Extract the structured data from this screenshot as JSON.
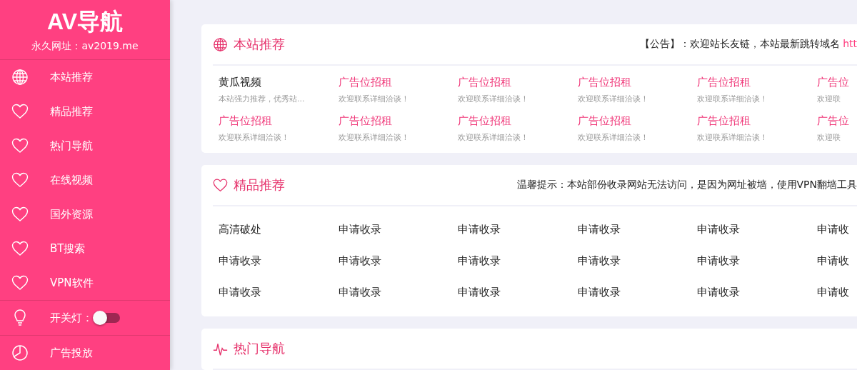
{
  "sidebar": {
    "logo": "AV导航",
    "permanent_url": "永久网址：av2019.me",
    "items": [
      {
        "label": "本站推荐"
      },
      {
        "label": "精品推荐"
      },
      {
        "label": "热门导航"
      },
      {
        "label": "在线视频"
      },
      {
        "label": "国外资源"
      },
      {
        "label": "BT搜索"
      },
      {
        "label": "VPN软件"
      }
    ],
    "light_switch": {
      "label": "开关灯：",
      "on": false
    },
    "footer_item": {
      "label": "广告投放"
    }
  },
  "sections": [
    {
      "title": "本站推荐",
      "notice": "【公告】：欢迎站长友链，本站最新跳转域名 ",
      "notice_link": "htt",
      "links": [
        {
          "kind": "featured",
          "name": "黄瓜视频",
          "desc": "本站强力推荐，优秀站..."
        },
        {
          "kind": "ad",
          "name": "广告位招租",
          "desc": "欢迎联系详细洽谈！"
        },
        {
          "kind": "ad",
          "name": "广告位招租",
          "desc": "欢迎联系详细洽谈！"
        },
        {
          "kind": "ad",
          "name": "广告位招租",
          "desc": "欢迎联系详细洽谈！"
        },
        {
          "kind": "ad",
          "name": "广告位招租",
          "desc": "欢迎联系详细洽谈！"
        },
        {
          "kind": "ad",
          "name": "广告位",
          "desc": "欢迎联"
        },
        {
          "kind": "ad",
          "name": "广告位招租",
          "desc": "欢迎联系详细洽谈！"
        },
        {
          "kind": "ad",
          "name": "广告位招租",
          "desc": "欢迎联系详细洽谈！"
        },
        {
          "kind": "ad",
          "name": "广告位招租",
          "desc": "欢迎联系详细洽谈！"
        },
        {
          "kind": "ad",
          "name": "广告位招租",
          "desc": "欢迎联系详细洽谈！"
        },
        {
          "kind": "ad",
          "name": "广告位招租",
          "desc": "欢迎联系详细洽谈！"
        },
        {
          "kind": "ad",
          "name": "广告位",
          "desc": "欢迎联"
        }
      ]
    },
    {
      "title": "精品推荐",
      "notice": "温馨提示：本站部份收录网站无法访问，是因为网址被墙，使用VPN翻墙工具",
      "links": [
        {
          "kind": "plain",
          "name": "高清破处"
        },
        {
          "kind": "plain",
          "name": "申请收录"
        },
        {
          "kind": "plain",
          "name": "申请收录"
        },
        {
          "kind": "plain",
          "name": "申请收录"
        },
        {
          "kind": "plain",
          "name": "申请收录"
        },
        {
          "kind": "plain",
          "name": "申请收"
        },
        {
          "kind": "plain",
          "name": "申请收录"
        },
        {
          "kind": "plain",
          "name": "申请收录"
        },
        {
          "kind": "plain",
          "name": "申请收录"
        },
        {
          "kind": "plain",
          "name": "申请收录"
        },
        {
          "kind": "plain",
          "name": "申请收录"
        },
        {
          "kind": "plain",
          "name": "申请收"
        },
        {
          "kind": "plain",
          "name": "申请收录"
        },
        {
          "kind": "plain",
          "name": "申请收录"
        },
        {
          "kind": "plain",
          "name": "申请收录"
        },
        {
          "kind": "plain",
          "name": "申请收录"
        },
        {
          "kind": "plain",
          "name": "申请收录"
        },
        {
          "kind": "plain",
          "name": "申请收"
        }
      ]
    },
    {
      "title": "热门导航"
    }
  ]
}
